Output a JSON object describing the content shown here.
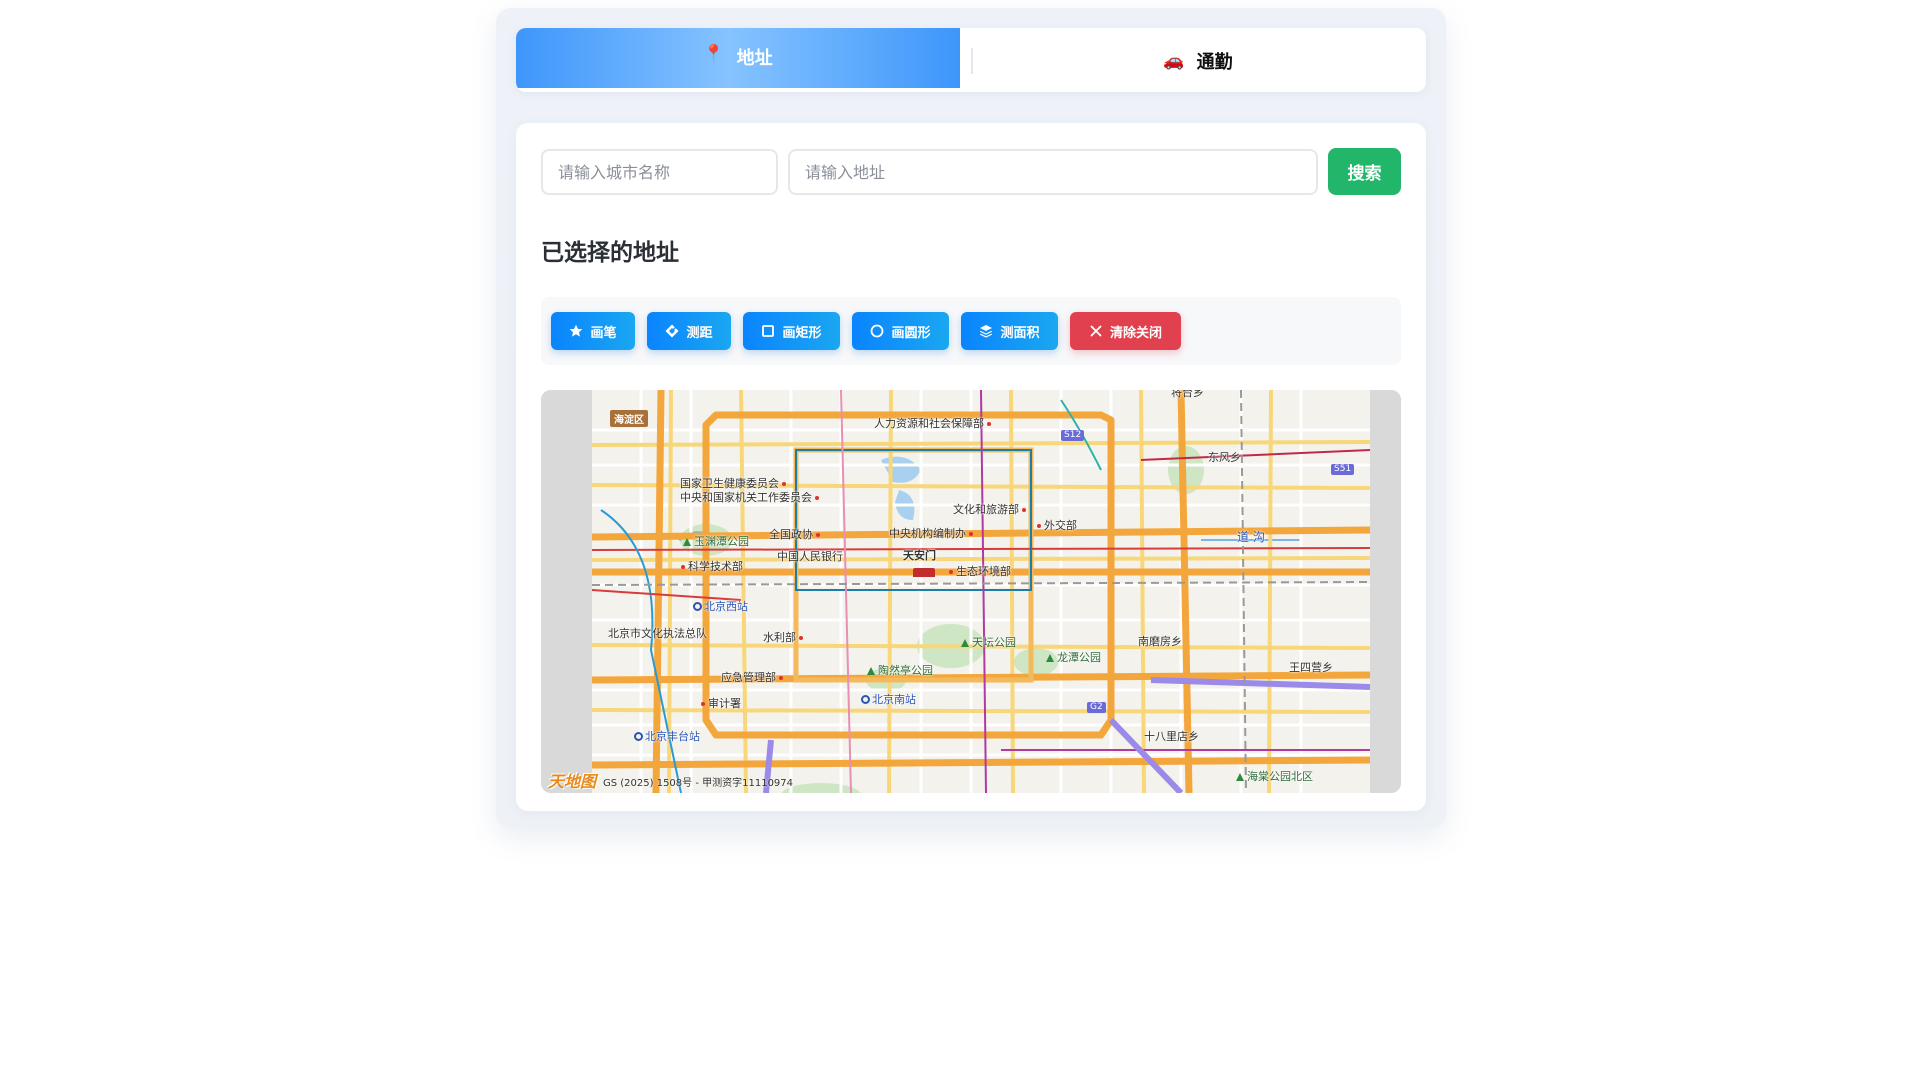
{
  "tabs": [
    {
      "label": "地址",
      "icon": "📍",
      "active": true
    },
    {
      "label": "通勤",
      "icon": "🚗",
      "active": false
    }
  ],
  "search": {
    "city_placeholder": "请输入城市名称",
    "city_value": "",
    "address_placeholder": "请输入地址",
    "address_value": "",
    "button_label": "搜索"
  },
  "section_title": "已选择的地址",
  "tools": {
    "brush": "画笔",
    "distance": "测距",
    "rectangle": "画矩形",
    "circle": "画圆形",
    "area": "测面积",
    "clear": "清除关闭"
  },
  "map": {
    "district": "海淀区",
    "logo": "天地图",
    "copyright": "GS (2025) 1508号 - 甲测资字11110974",
    "route_badges": [
      "S12",
      "S51",
      "G2"
    ],
    "labels": {
      "l1": "人力资源和社会保障部",
      "l2": "国家卫生健康委员会",
      "l3": "中央和国家机关工作委员会",
      "l4": "文化和旅游部",
      "l5": "外交部",
      "l6": "玉渊潭公园",
      "l7": "全国政协",
      "l8": "中央机构编制办",
      "l9": "中国人民银行",
      "l10": "天安门",
      "l11": "科学技术部",
      "l12": "生态环境部",
      "l13": "北京西站",
      "l14": "北京市文化执法总队",
      "l15": "水利部",
      "l16": "天坛公园",
      "l17": "龙潭公园",
      "l18": "南磨房乡",
      "l19": "王四营乡",
      "l20": "陶然亭公园",
      "l21": "应急管理部",
      "l22": "北京南站",
      "l23": "审计署",
      "l24": "北京丰台站",
      "l25": "十八里店乡",
      "l26": "海棠公园北区",
      "l27": "东风乡",
      "l28": "道  沟",
      "l29": "将台乡"
    }
  },
  "colors": {
    "tab_active": "#3e96fb",
    "search_button": "#22b66a",
    "tool_button": "#0a84ff",
    "clear_button": "#e1414e"
  }
}
